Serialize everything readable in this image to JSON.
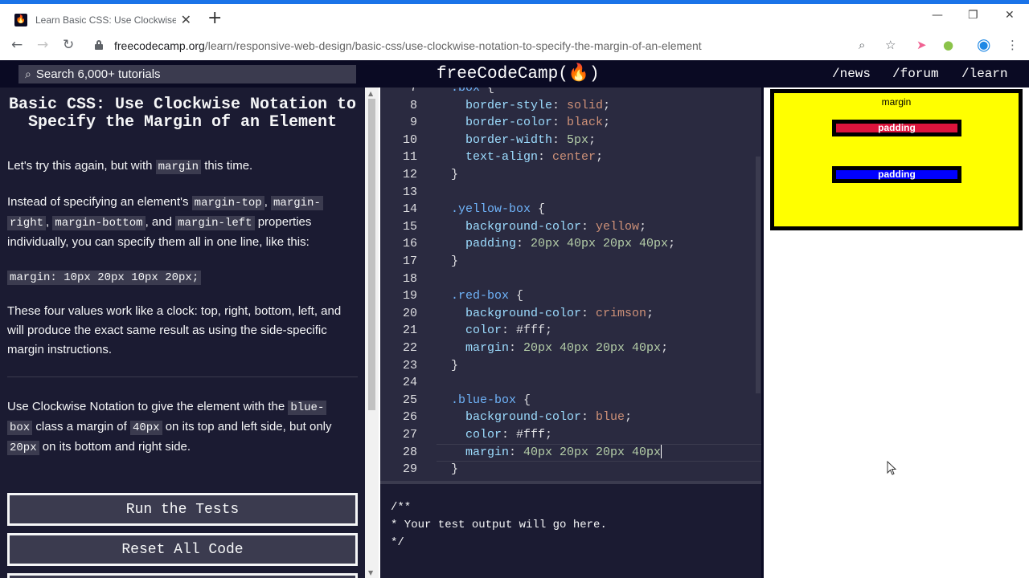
{
  "browser": {
    "tab_title": "Learn Basic CSS: Use Clockwise N",
    "tab_close": "✕",
    "new_tab": "+",
    "url_host": "freecodecamp.org",
    "url_path": "/learn/responsive-web-design/basic-css/use-clockwise-notation-to-specify-the-margin-of-an-element",
    "window_controls": [
      "—",
      "❐",
      "✕"
    ],
    "nav": [
      "←",
      "→",
      "↻"
    ],
    "toolbar_icons": [
      "zoom-icon",
      "star-icon",
      "extension-icon",
      "extension-icon-2",
      "profile-icon",
      "menu-icon"
    ],
    "accent_color": "#1a73e8"
  },
  "fcc_nav": {
    "search_placeholder": "Search 6,000+ tutorials",
    "logo": "freeCodeCamp(🔥)",
    "links": [
      "/news",
      "/forum",
      "/learn"
    ],
    "bg_color": "#0a0a23"
  },
  "lesson": {
    "title": "Basic CSS: Use Clockwise Notation to Specify the Margin of an Element",
    "p1_pre": "Let's try this again, but with ",
    "p1_code": "margin",
    "p1_post": " this time.",
    "p2_a": "Instead of specifying an element's ",
    "p2_c1": "margin-top",
    "p2_b": ", ",
    "p2_c2a": "margin-",
    "p2_c2b": "right",
    "p2_c": ", ",
    "p2_c3": "margin-bottom",
    "p2_d": ", and ",
    "p2_c4": "margin-left",
    "p2_e": " properties individually, you can specify them all in one line, like this:",
    "example_code": "margin: 10px 20px 10px 20px;",
    "p3": "These four values work like a clock: top, right, bottom, left, and will produce the exact same result as using the side-specific margin instructions.",
    "p4_a": "Use Clockwise Notation to give the element with the ",
    "p4_c1a": "blue-",
    "p4_c1b": "box",
    "p4_b": " class a margin of ",
    "p4_c2": "40px",
    "p4_c": " on its top and left side, but only ",
    "p4_c3": "20px",
    "p4_d": " on its bottom and right side.",
    "run_button": "Run the Tests",
    "reset_button": "Reset All Code"
  },
  "editor": {
    "lines": [
      {
        "n": "7",
        "parts": [
          [
            "sel",
            ".box"
          ],
          [
            "punc",
            " {"
          ]
        ]
      },
      {
        "n": "8",
        "parts": [
          [
            "prop",
            "  border-style"
          ],
          [
            "punc",
            ": "
          ],
          [
            "val",
            "solid"
          ],
          [
            "punc",
            ";"
          ]
        ]
      },
      {
        "n": "9",
        "parts": [
          [
            "prop",
            "  border-color"
          ],
          [
            "punc",
            ": "
          ],
          [
            "val",
            "black"
          ],
          [
            "punc",
            ";"
          ]
        ]
      },
      {
        "n": "10",
        "parts": [
          [
            "prop",
            "  border-width"
          ],
          [
            "punc",
            ": "
          ],
          [
            "num",
            "5px"
          ],
          [
            "punc",
            ";"
          ]
        ]
      },
      {
        "n": "11",
        "parts": [
          [
            "prop",
            "  text-align"
          ],
          [
            "punc",
            ": "
          ],
          [
            "val",
            "center"
          ],
          [
            "punc",
            ";"
          ]
        ]
      },
      {
        "n": "12",
        "parts": [
          [
            "punc",
            "}"
          ]
        ]
      },
      {
        "n": "13",
        "parts": []
      },
      {
        "n": "14",
        "parts": [
          [
            "sel",
            ".yellow-box"
          ],
          [
            "punc",
            " {"
          ]
        ]
      },
      {
        "n": "15",
        "parts": [
          [
            "prop",
            "  background-color"
          ],
          [
            "punc",
            ": "
          ],
          [
            "val",
            "yellow"
          ],
          [
            "punc",
            ";"
          ]
        ]
      },
      {
        "n": "16",
        "parts": [
          [
            "prop",
            "  padding"
          ],
          [
            "punc",
            ": "
          ],
          [
            "num",
            "20px 40px 20px 40px"
          ],
          [
            "punc",
            ";"
          ]
        ]
      },
      {
        "n": "17",
        "parts": [
          [
            "punc",
            "}"
          ]
        ]
      },
      {
        "n": "18",
        "parts": []
      },
      {
        "n": "19",
        "parts": [
          [
            "sel",
            ".red-box"
          ],
          [
            "punc",
            " {"
          ]
        ]
      },
      {
        "n": "20",
        "parts": [
          [
            "prop",
            "  background-color"
          ],
          [
            "punc",
            ": "
          ],
          [
            "val",
            "crimson"
          ],
          [
            "punc",
            ";"
          ]
        ]
      },
      {
        "n": "21",
        "parts": [
          [
            "prop",
            "  color"
          ],
          [
            "punc",
            ": "
          ],
          [
            "punc",
            "#fff"
          ],
          [
            "punc",
            ";"
          ]
        ]
      },
      {
        "n": "22",
        "parts": [
          [
            "prop",
            "  margin"
          ],
          [
            "punc",
            ": "
          ],
          [
            "num",
            "20px 40px 20px 40px"
          ],
          [
            "punc",
            ";"
          ]
        ]
      },
      {
        "n": "23",
        "parts": [
          [
            "punc",
            "}"
          ]
        ]
      },
      {
        "n": "24",
        "parts": []
      },
      {
        "n": "25",
        "parts": [
          [
            "sel",
            ".blue-box"
          ],
          [
            "punc",
            " {"
          ]
        ]
      },
      {
        "n": "26",
        "parts": [
          [
            "prop",
            "  background-color"
          ],
          [
            "punc",
            ": "
          ],
          [
            "val",
            "blue"
          ],
          [
            "punc",
            ";"
          ]
        ]
      },
      {
        "n": "27",
        "parts": [
          [
            "prop",
            "  color"
          ],
          [
            "punc",
            ": "
          ],
          [
            "punc",
            "#fff"
          ],
          [
            "punc",
            ";"
          ]
        ]
      },
      {
        "n": "28",
        "parts": [
          [
            "prop",
            "  margin"
          ],
          [
            "punc",
            ": "
          ],
          [
            "num",
            "40px 20px 20px 40px"
          ]
        ]
      },
      {
        "n": "29",
        "parts": [
          [
            "punc",
            "}"
          ]
        ]
      }
    ],
    "current_line": "28",
    "bg_color": "#2a2a40"
  },
  "output": {
    "text": "/**\n* Your test output will go here.\n*/"
  },
  "preview": {
    "margin_label": "margin",
    "red_label": "padding",
    "blue_label": "padding",
    "red_color": "crimson",
    "blue_color": "blue",
    "yellow_color": "yellow"
  }
}
